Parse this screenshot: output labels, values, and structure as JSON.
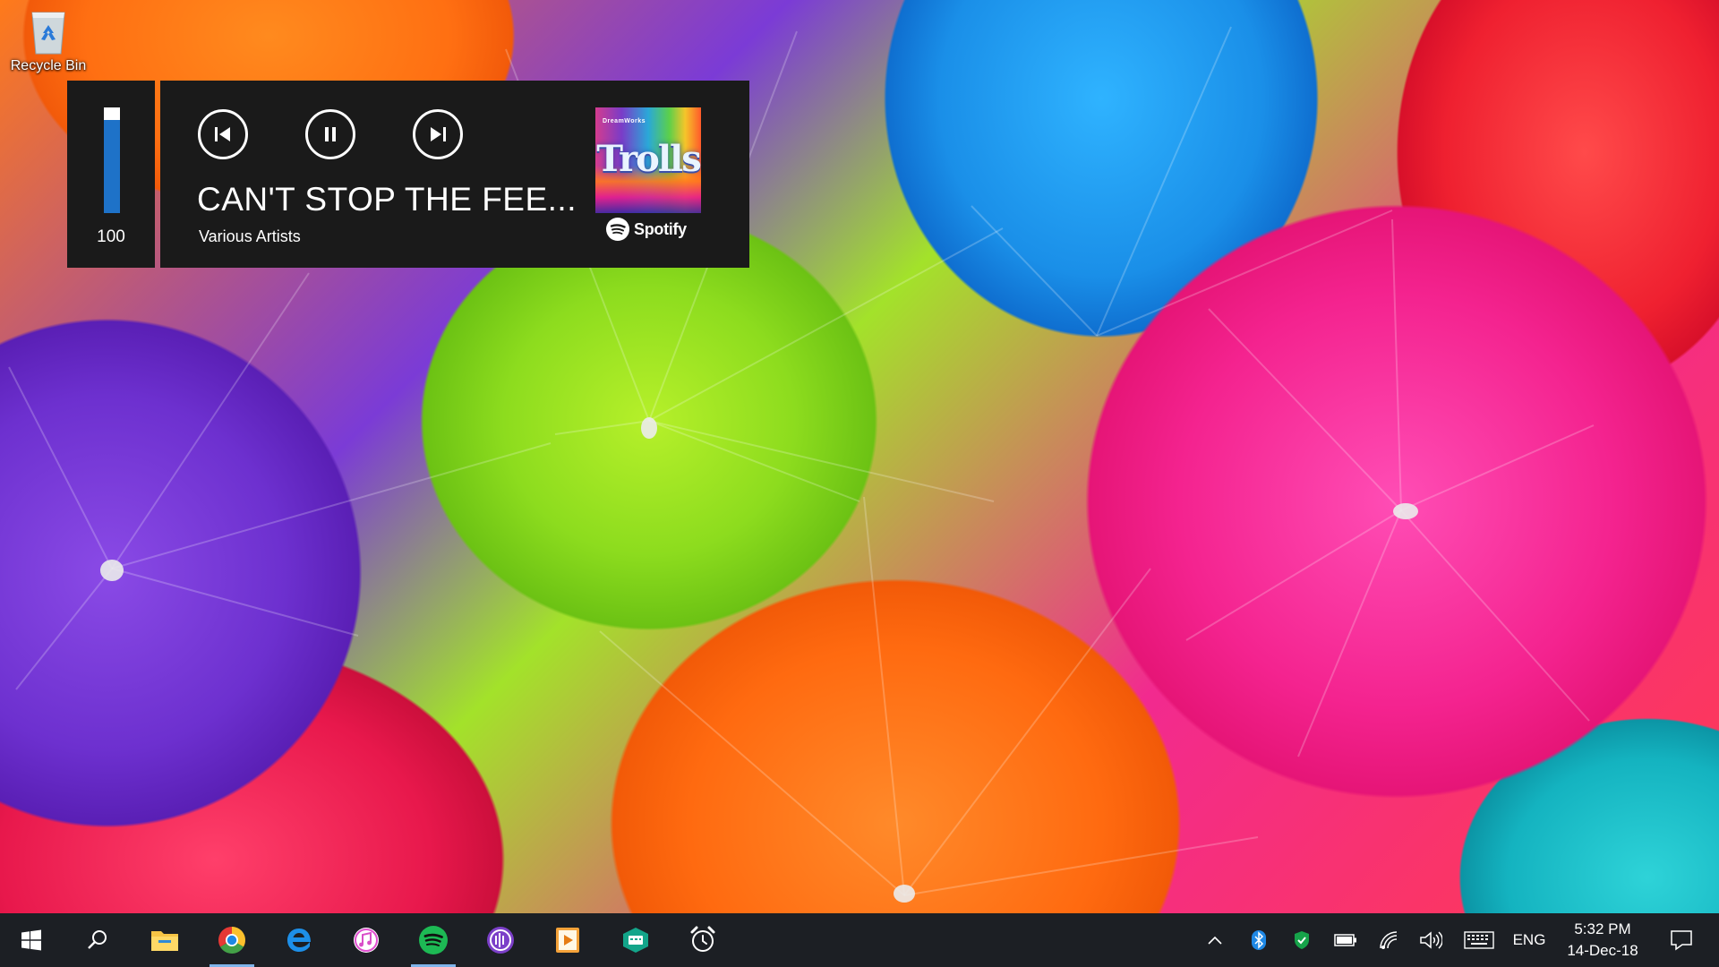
{
  "desktop": {
    "recycle_bin_label": "Recycle Bin"
  },
  "media_overlay": {
    "volume_value": "100",
    "volume_level_percent": 100,
    "track_title": "CAN'T STOP THE FEE...",
    "artist": "Various Artists",
    "album_art_text": "Trolls",
    "album_art_studio": "DreamWorks",
    "source_app": "Spotify",
    "controls": [
      "previous-track",
      "pause",
      "next-track"
    ]
  },
  "taskbar": {
    "pinned_apps": [
      "start",
      "search",
      "file-explorer",
      "chrome",
      "edge",
      "itunes",
      "spotify",
      "podcast-app",
      "media-player",
      "chat-app",
      "alarm-clock"
    ],
    "active_apps": [
      "chrome",
      "spotify"
    ],
    "tray": {
      "language": "ENG",
      "time": "5:32 PM",
      "date": "14-Dec-18"
    }
  },
  "colors": {
    "overlay_bg": "#1a1a1a",
    "volume_blue": "#1e72c8",
    "taskbar_bg": "#1c1f24",
    "spotify_green": "#1db954",
    "active_indicator": "#7eb4ea"
  }
}
